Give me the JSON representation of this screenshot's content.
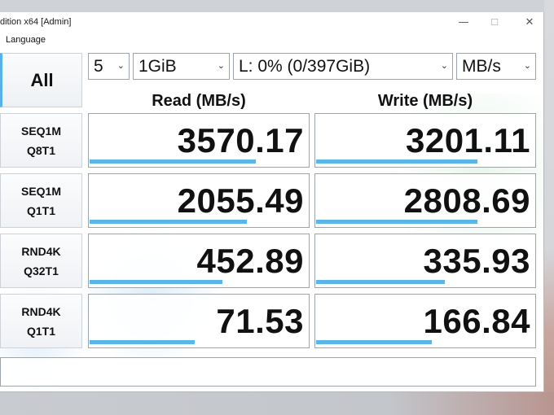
{
  "window": {
    "title": "dition x64 [Admin]",
    "controls": {
      "minimize": "—",
      "maximize": "☐",
      "close": "✕"
    }
  },
  "menu": {
    "items": [
      "Language"
    ]
  },
  "controls": {
    "all_button": "All",
    "count": "5",
    "size": "1GiB",
    "drive": "L: 0% (0/397GiB)",
    "unit": "MB/s"
  },
  "headers": {
    "read": "Read (MB/s)",
    "write": "Write (MB/s)"
  },
  "tests": [
    {
      "line1": "SEQ1M",
      "line2": "Q8T1",
      "read": "3570.17",
      "write": "3201.11",
      "read_fraction": 0.76,
      "write_fraction": 0.74
    },
    {
      "line1": "SEQ1M",
      "line2": "Q1T1",
      "read": "2055.49",
      "write": "2808.69",
      "read_fraction": 0.72,
      "write_fraction": 0.74
    },
    {
      "line1": "RND4K",
      "line2": "Q32T1",
      "read": "452.89",
      "write": "335.93",
      "read_fraction": 0.61,
      "write_fraction": 0.59
    },
    {
      "line1": "RND4K",
      "line2": "Q1T1",
      "read": "71.53",
      "write": "166.84",
      "read_fraction": 0.48,
      "write_fraction": 0.53
    }
  ],
  "comment": "",
  "colors": {
    "bar": "#5ab6e6",
    "accent": "#5ab0e8"
  }
}
